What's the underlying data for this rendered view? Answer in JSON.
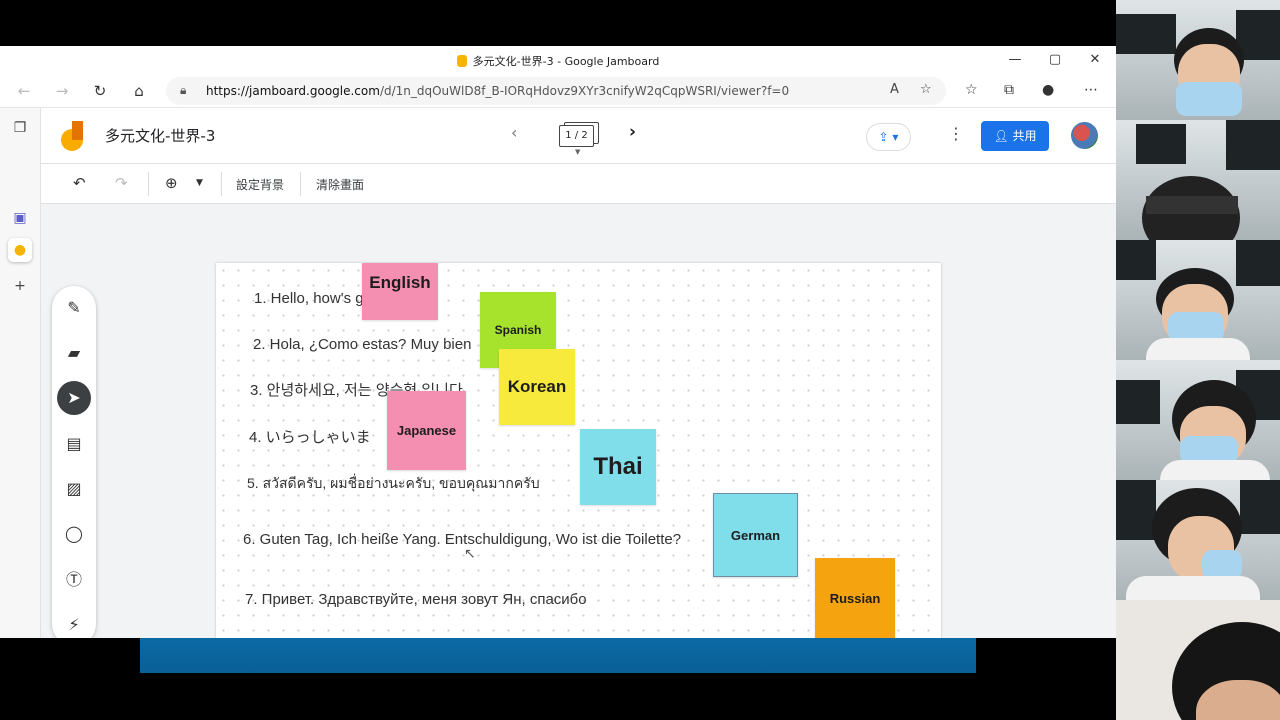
{
  "browser": {
    "window_title": "多元文化-世界-3 - Google Jamboard",
    "url_host": "https://jamboard.google.com",
    "url_path": "/d/1n_dqOuWlD8f_B-IORqHdovz9XYr3cnifyW2qCqpWSRI/viewer?f=0",
    "window_controls": {
      "minimize": "—",
      "maximize": "▢",
      "close": "✕"
    }
  },
  "jamboard": {
    "title": "多元文化-世界-3",
    "page_indicator": "1 / 2",
    "share_label": "共用",
    "toolbar": {
      "set_background": "設定背景",
      "clear_frame": "清除畫面"
    }
  },
  "canvas": {
    "lines": [
      "1. Hello, how's going on?",
      "2. Hola, ¿Como estas? Muy bien",
      "3. 안녕하세요, 저는 양승혁 입니다",
      "4. いらっしゃいま",
      "5. สวัสดีครับ, ผมชื่อย่างนะครับ, ขอบคุณมากครับ",
      "6. Guten Tag, Ich heiße Yang. Entschuldigung, Wo ist die Toilette?",
      "7. Привет. Здравствуйте, меня зовут Ян, спасибо"
    ],
    "notes": [
      {
        "label": "English",
        "color": "#f48fb1"
      },
      {
        "label": "Spanish",
        "color": "#a7e32c"
      },
      {
        "label": "Korean",
        "color": "#f7ea3d"
      },
      {
        "label": "Japanese",
        "color": "#f48fb1"
      },
      {
        "label": "Thai",
        "color": "#80deea"
      },
      {
        "label": "German",
        "color": "#80deea"
      },
      {
        "label": "Russian",
        "color": "#f5a30f"
      }
    ]
  },
  "colors": {
    "accent": "#1a73e8",
    "teams_bar": "#0b6aa5"
  },
  "icons": {
    "back": "arrow-left-icon",
    "forward": "arrow-right-icon",
    "refresh": "refresh-icon",
    "home": "home-icon",
    "lock": "lock-icon",
    "undo": "undo-icon",
    "redo": "redo-icon",
    "zoom": "zoom-in-icon",
    "pen": "pen-icon",
    "eraser": "eraser-icon",
    "select": "pointer-icon",
    "sticky": "sticky-note-icon",
    "image": "image-icon",
    "shape": "circle-icon",
    "textbox": "text-box-icon",
    "laser": "laser-icon"
  }
}
